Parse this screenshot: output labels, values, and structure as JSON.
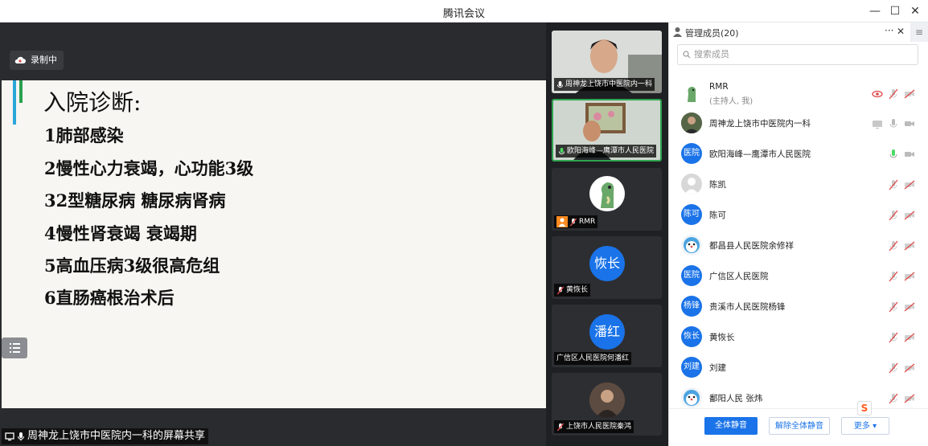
{
  "window": {
    "title": "腾讯会议",
    "minimize": "—",
    "maximize": "☐",
    "close": "✕"
  },
  "stage": {
    "recording_badge": "录制中",
    "share_label": "周神龙上饶市中医院内一科的屏幕共享",
    "slide": {
      "heading": "入院诊断:",
      "lines": [
        "1肺部感染",
        "2慢性心力衰竭，心功能3级",
        "32型糖尿病 糖尿病肾病",
        "4慢性肾衰竭 衰竭期",
        "5高血压病3级很高危组",
        "6直肠癌根治术后"
      ]
    }
  },
  "video_strip": [
    {
      "label": "周神龙上饶市中医院内一科",
      "kind": "video-face",
      "active": false
    },
    {
      "label": "欧阳海峰—鹰潭市人民医院",
      "kind": "video-room",
      "active": true
    },
    {
      "label": "RMR",
      "kind": "dino",
      "active": false
    },
    {
      "label": "黄恢长",
      "kind": "initials",
      "initials": "恢长",
      "active": false
    },
    {
      "label": "广信区人民医院何潘红",
      "kind": "initials",
      "initials": "潘红",
      "active": false
    },
    {
      "label": "上饶市人民医院秦鸿",
      "kind": "photo",
      "active": false
    }
  ],
  "panel": {
    "title": "管理成员(20)",
    "more": "···",
    "close": "✕",
    "menu": "≡",
    "search_placeholder": "搜索成员",
    "members": [
      {
        "name": "RMR",
        "sub": "(主持人, 我)",
        "avatar": "dino",
        "initials": ""
      },
      {
        "name": "周神龙上饶市中医院内一科",
        "sub": "",
        "avatar": "photo",
        "initials": ""
      },
      {
        "name": "欧阳海峰—鹰潭市人民医院",
        "sub": "",
        "avatar": "initials",
        "initials": "医院"
      },
      {
        "name": "陈凯",
        "sub": "",
        "avatar": "default",
        "initials": ""
      },
      {
        "name": "陈可",
        "sub": "",
        "avatar": "initials",
        "initials": "陈可"
      },
      {
        "name": "都昌县人民医院余修祥",
        "sub": "",
        "avatar": "cartoon",
        "initials": ""
      },
      {
        "name": "广信区人民医院",
        "sub": "",
        "avatar": "initials",
        "initials": "医院"
      },
      {
        "name": "贵溪市人民医院杨锋",
        "sub": "",
        "avatar": "initials",
        "initials": "杨锋"
      },
      {
        "name": "黄恢长",
        "sub": "",
        "avatar": "initials",
        "initials": "恢长"
      },
      {
        "name": "刘建",
        "sub": "",
        "avatar": "initials",
        "initials": "刘建"
      },
      {
        "name": "鄱阳人民 张炜",
        "sub": "",
        "avatar": "cartoon",
        "initials": ""
      }
    ],
    "footer": {
      "mute_all": "全体静音",
      "unmute_all": "解除全体静音",
      "more": "更多 ▾"
    }
  },
  "colors": {
    "accent": "#1a73e8",
    "active_border": "#2ea44f",
    "muted_icon": "#e04848"
  }
}
